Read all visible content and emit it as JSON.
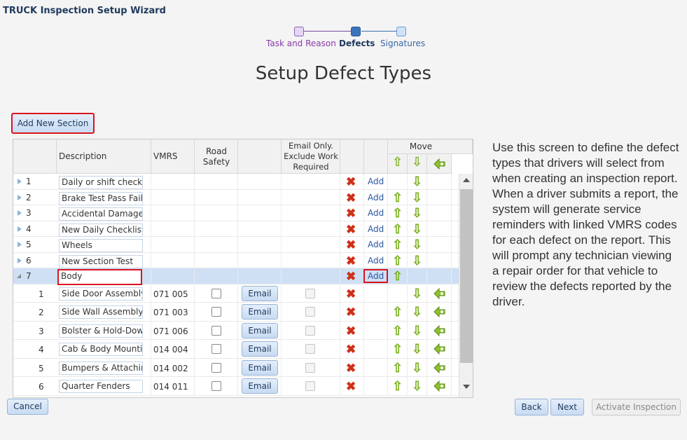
{
  "app": {
    "title": "TRUCK Inspection Setup Wizard"
  },
  "wizard": {
    "steps": [
      {
        "label": "Task and Reason",
        "state": "done"
      },
      {
        "label": "Defects",
        "state": "current"
      },
      {
        "label": "Signatures",
        "state": "upcoming"
      }
    ]
  },
  "page": {
    "heading": "Setup Defect Types"
  },
  "toolbar": {
    "add_section_label": "Add New Section"
  },
  "grid": {
    "headers": {
      "description": "Description",
      "vmrs": "VMRS",
      "road_safety": "Road Safety",
      "email_only": "Email Only. Exclude Work Required",
      "move": "Move"
    },
    "sections": [
      {
        "num": "1",
        "desc": "Daily or shift check",
        "add": "Add",
        "up": false,
        "down": true
      },
      {
        "num": "2",
        "desc": "Brake Test Pass Fail",
        "add": "Add",
        "up": true,
        "down": true
      },
      {
        "num": "3",
        "desc": "Accidental Damage",
        "add": "Add",
        "up": true,
        "down": true
      },
      {
        "num": "4",
        "desc": "New Daily Checklist",
        "add": "Add",
        "up": true,
        "down": true
      },
      {
        "num": "5",
        "desc": "Wheels",
        "add": "Add",
        "up": true,
        "down": true
      },
      {
        "num": "6",
        "desc": "New Section Test",
        "add": "Add",
        "up": true,
        "down": true
      },
      {
        "num": "7",
        "desc": "Body",
        "add": "Add",
        "up": true,
        "down": false,
        "expanded": true
      }
    ],
    "items": [
      {
        "num": "1",
        "desc": "Side Door Assembly",
        "vmrs": "071 005",
        "email": "Email",
        "up": false
      },
      {
        "num": "2",
        "desc": "Side Wall Assembly",
        "vmrs": "071 003",
        "email": "Email",
        "up": true
      },
      {
        "num": "3",
        "desc": "Bolster & Hold-Down",
        "vmrs": "071 006",
        "email": "Email",
        "up": true
      },
      {
        "num": "4",
        "desc": "Cab & Body Mounting",
        "vmrs": "014 004",
        "email": "Email",
        "up": true
      },
      {
        "num": "5",
        "desc": "Bumpers & Attaching",
        "vmrs": "014 002",
        "email": "Email",
        "up": true
      },
      {
        "num": "6",
        "desc": "Quarter Fenders",
        "vmrs": "014 011",
        "email": "Email",
        "up": true
      }
    ]
  },
  "help": {
    "text": "Use this screen to define the defect types that drivers will select from when creating an inspection report. When a driver submits a report, the system will generate service reminders with linked VMRS codes for each defect on the report. This will prompt any technician viewing a repair order for that vehicle to review the defects reported by the driver."
  },
  "footer": {
    "cancel": "Cancel",
    "back": "Back",
    "next": "Next",
    "activate": "Activate Inspection"
  },
  "colors": {
    "accent": "#1f3a5c",
    "highlight": "#d9141e",
    "selected_row": "#cfe0f5",
    "arrow": "#7ab01c",
    "delete": "#d03018"
  },
  "icons": [
    "expand-arrow-icon",
    "collapse-arrow-icon",
    "delete-x-icon",
    "arrow-up-icon",
    "arrow-down-icon",
    "move-to-section-icon",
    "scroll-up-icon",
    "scroll-down-icon"
  ]
}
